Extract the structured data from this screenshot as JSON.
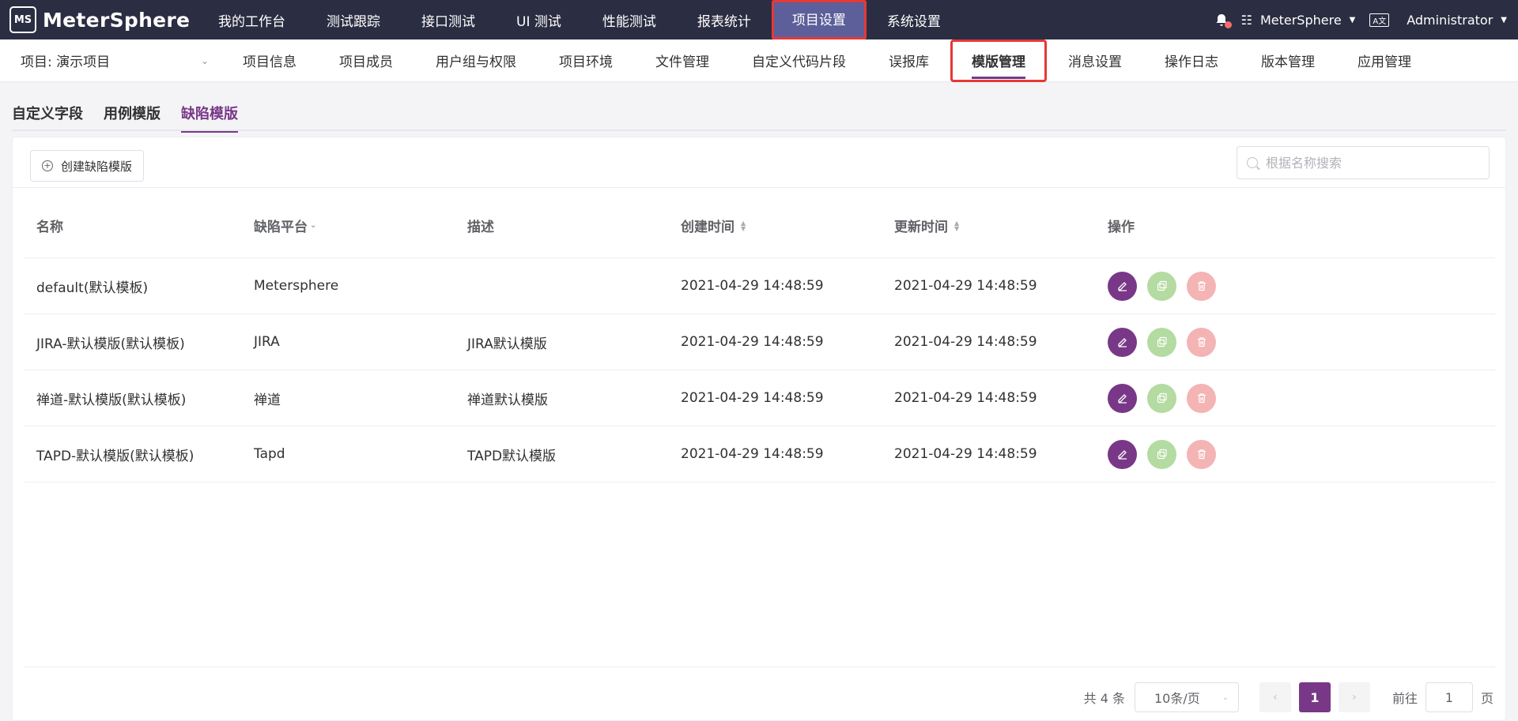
{
  "topbar": {
    "logo_text": "MeterSphere",
    "logo_mark": "MS",
    "nav": [
      {
        "label": "我的工作台"
      },
      {
        "label": "测试跟踪"
      },
      {
        "label": "接口测试"
      },
      {
        "label": "UI 测试"
      },
      {
        "label": "性能测试"
      },
      {
        "label": "报表统计"
      },
      {
        "label": "项目设置"
      },
      {
        "label": "系统设置"
      }
    ],
    "active_nav": "项目设置",
    "workspace": "MeterSphere",
    "lang_icon": "A文",
    "user": "Administrator"
  },
  "subbar": {
    "project_select": "项目: 演示项目",
    "nav": [
      {
        "label": "项目信息"
      },
      {
        "label": "项目成员"
      },
      {
        "label": "用户组与权限"
      },
      {
        "label": "项目环境"
      },
      {
        "label": "文件管理"
      },
      {
        "label": "自定义代码片段"
      },
      {
        "label": "误报库"
      },
      {
        "label": "模版管理"
      },
      {
        "label": "消息设置"
      },
      {
        "label": "操作日志"
      },
      {
        "label": "版本管理"
      },
      {
        "label": "应用管理"
      }
    ],
    "active_nav": "模版管理"
  },
  "tabs": [
    {
      "label": "自定义字段"
    },
    {
      "label": "用例模版"
    },
    {
      "label": "缺陷模版"
    }
  ],
  "active_tab": "缺陷模版",
  "toolbar": {
    "create_label": "创建缺陷模版",
    "search_placeholder": "根据名称搜索"
  },
  "table": {
    "headers": {
      "name": "名称",
      "platform": "缺陷平台",
      "description": "描述",
      "created": "创建时间",
      "updated": "更新时间",
      "ops": "操作"
    },
    "rows": [
      {
        "name": "default(默认模板)",
        "platform": "Metersphere",
        "description": "",
        "created": "2021-04-29 14:48:59",
        "updated": "2021-04-29 14:48:59"
      },
      {
        "name": "JIRA-默认模版(默认模板)",
        "platform": "JIRA",
        "description": "JIRA默认模版",
        "created": "2021-04-29 14:48:59",
        "updated": "2021-04-29 14:48:59"
      },
      {
        "name": "禅道-默认模版(默认模板)",
        "platform": "禅道",
        "description": "禅道默认模版",
        "created": "2021-04-29 14:48:59",
        "updated": "2021-04-29 14:48:59"
      },
      {
        "name": "TAPD-默认模版(默认模板)",
        "platform": "Tapd",
        "description": "TAPD默认模版",
        "created": "2021-04-29 14:48:59",
        "updated": "2021-04-29 14:48:59"
      }
    ]
  },
  "pagination": {
    "total": "共 4 条",
    "page_size": "10条/页",
    "current_page": "1",
    "goto_label": "前往",
    "goto_value": "1",
    "page_suffix": "页"
  },
  "colors": {
    "primary": "#783887",
    "topbar": "#2b2d42",
    "highlight_box": "#e53935"
  }
}
